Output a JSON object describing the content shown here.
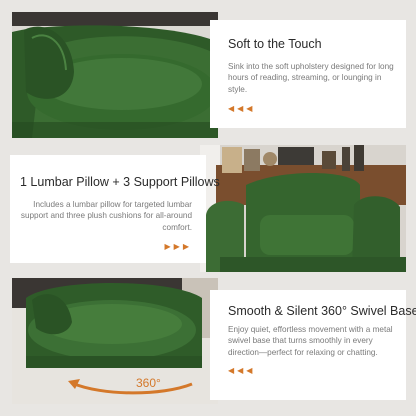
{
  "colors": {
    "accent": "#d4782a",
    "upholstery": "#2f5f2a",
    "panel": "#ffffff"
  },
  "sections": [
    {
      "title": "Soft to the Touch",
      "body": "Sink into the soft upholstery designed for long hours of reading, streaming, or lounging in style.",
      "arrows": "◀◀◀"
    },
    {
      "title": "1 Lumbar Pillow + 3 Support Pillows",
      "body": "Includes a lumbar pillow for targeted lumbar support and three plush cushions for all-around comfort.",
      "arrows": "▶▶▶"
    },
    {
      "title": "Smooth & Silent 360° Swivel Base",
      "body": "Enjoy quiet, effortless movement with a metal swivel base that turns smoothly in every direction—perfect for relaxing or chatting.",
      "arrows": "◀◀◀",
      "photo_label": "360°"
    }
  ]
}
